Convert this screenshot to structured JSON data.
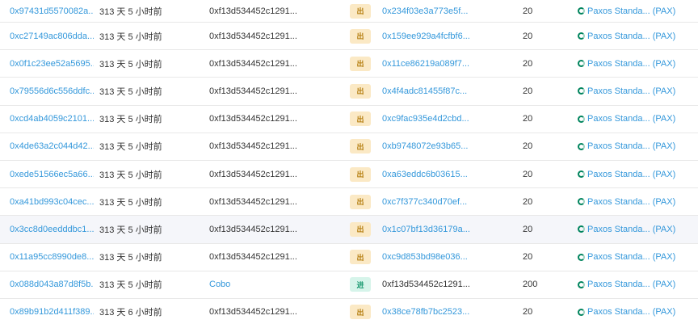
{
  "colors": {
    "link": "#3498db",
    "out_badge_bg": "#fbe9c5",
    "out_badge_text": "#b47d0e",
    "in_badge_bg": "#d6f4ea",
    "in_badge_text": "#1f9c74",
    "row_highlight": "#f5f6fa"
  },
  "icons": {
    "token": "paxos-token-icon"
  },
  "rows": [
    {
      "hash": "0x97431d5570082a...",
      "age": "313 天 5 小时前",
      "from": "0xf13d534452c1291...",
      "from_link": false,
      "direction": "出",
      "to": "0x234f03e3a773e5f...",
      "to_link": true,
      "value": "20",
      "token": "Paxos Standa... (PAX)"
    },
    {
      "hash": "0xc27149ac806dda...",
      "age": "313 天 5 小时前",
      "from": "0xf13d534452c1291...",
      "from_link": false,
      "direction": "出",
      "to": "0x159ee929a4fcfbf6...",
      "to_link": true,
      "value": "20",
      "token": "Paxos Standa... (PAX)"
    },
    {
      "hash": "0x0f1c23ee52a5695...",
      "age": "313 天 5 小时前",
      "from": "0xf13d534452c1291...",
      "from_link": false,
      "direction": "出",
      "to": "0x11ce86219a089f7...",
      "to_link": true,
      "value": "20",
      "token": "Paxos Standa... (PAX)"
    },
    {
      "hash": "0x79556d6c556ddfc...",
      "age": "313 天 5 小时前",
      "from": "0xf13d534452c1291...",
      "from_link": false,
      "direction": "出",
      "to": "0x4f4adc81455f87c...",
      "to_link": true,
      "value": "20",
      "token": "Paxos Standa... (PAX)"
    },
    {
      "hash": "0xcd4ab4059c2101...",
      "age": "313 天 5 小时前",
      "from": "0xf13d534452c1291...",
      "from_link": false,
      "direction": "出",
      "to": "0xc9fac935e4d2cbd...",
      "to_link": true,
      "value": "20",
      "token": "Paxos Standa... (PAX)"
    },
    {
      "hash": "0x4de63a2c044d42...",
      "age": "313 天 5 小时前",
      "from": "0xf13d534452c1291...",
      "from_link": false,
      "direction": "出",
      "to": "0xb9748072e93b65...",
      "to_link": true,
      "value": "20",
      "token": "Paxos Standa... (PAX)"
    },
    {
      "hash": "0xede51566ec5a66...",
      "age": "313 天 5 小时前",
      "from": "0xf13d534452c1291...",
      "from_link": false,
      "direction": "出",
      "to": "0xa63eddc6b03615...",
      "to_link": true,
      "value": "20",
      "token": "Paxos Standa... (PAX)"
    },
    {
      "hash": "0xa41bd993c04cec...",
      "age": "313 天 5 小时前",
      "from": "0xf13d534452c1291...",
      "from_link": false,
      "direction": "出",
      "to": "0xc7f377c340d70ef...",
      "to_link": true,
      "value": "20",
      "token": "Paxos Standa... (PAX)"
    },
    {
      "hash": "0x3cc8d0eedddbc1...",
      "age": "313 天 5 小时前",
      "from": "0xf13d534452c1291...",
      "from_link": false,
      "direction": "出",
      "to": "0x1c07bf13d36179a...",
      "to_link": true,
      "value": "20",
      "token": "Paxos Standa... (PAX)"
    },
    {
      "hash": "0x11a95cc8990de8...",
      "age": "313 天 5 小时前",
      "from": "0xf13d534452c1291...",
      "from_link": false,
      "direction": "出",
      "to": "0xc9d853bd98e036...",
      "to_link": true,
      "value": "20",
      "token": "Paxos Standa... (PAX)"
    },
    {
      "hash": "0x088d043a87d8f5b...",
      "age": "313 天 5 小时前",
      "from": "Cobo",
      "from_link": true,
      "direction": "进",
      "to": "0xf13d534452c1291...",
      "to_link": false,
      "value": "200",
      "token": "Paxos Standa... (PAX)"
    },
    {
      "hash": "0x89b91b2d411f389...",
      "age": "313 天 6 小时前",
      "from": "0xf13d534452c1291...",
      "from_link": false,
      "direction": "出",
      "to": "0x38ce78fb7bc2523...",
      "to_link": true,
      "value": "20",
      "token": "Paxos Standa... (PAX)"
    }
  ]
}
